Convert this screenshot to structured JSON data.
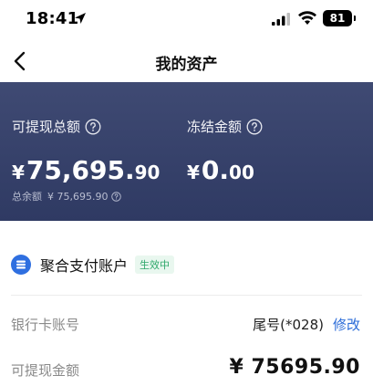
{
  "status_bar": {
    "time": "18:41",
    "battery": "81"
  },
  "nav": {
    "title": "我的资产"
  },
  "balance": {
    "withdrawable_label": "可提现总额",
    "withdrawable_currency": "¥",
    "withdrawable_int": "75,695.",
    "withdrawable_dec": "90",
    "total_label": "总余额",
    "total_value": "¥ 75,695.90",
    "frozen_label": "冻结金额",
    "frozen_currency": "¥",
    "frozen_int": "0.",
    "frozen_dec": "00"
  },
  "account": {
    "title": "聚合支付账户",
    "status_badge": "生效中",
    "bank_label": "银行卡账号",
    "tail_number": "尾号(*028)",
    "edit_label": "修改",
    "withdrawable_label": "可提现金额",
    "withdrawable_amount": "¥ 75695.90"
  },
  "colors": {
    "card_bg": "#36416b",
    "link": "#2a6bd8",
    "badge_green": "#2fa86b",
    "account_icon_blue": "#2f6fe0"
  }
}
